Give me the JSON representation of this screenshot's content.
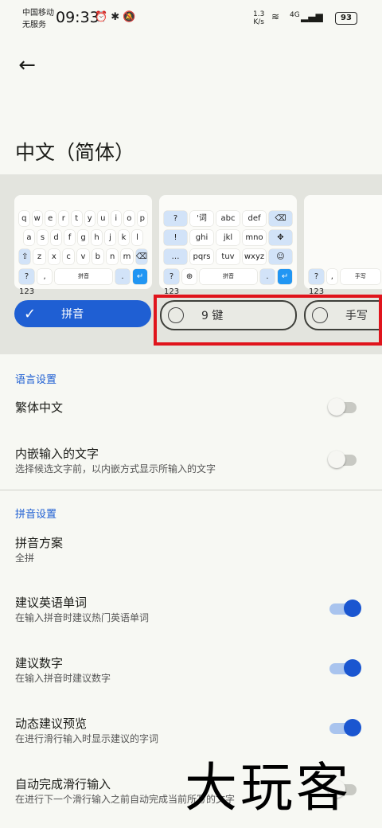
{
  "status": {
    "carrier_line1": "中国移动",
    "carrier_line2": "无服务",
    "time": "09:33",
    "net_speed": "1.3",
    "net_unit": "K/s",
    "signal": "4G",
    "battery": "93"
  },
  "header": {
    "title": "中文（简体）"
  },
  "keyboards": {
    "qwerty_rows": [
      [
        "q",
        "w",
        "e",
        "r",
        "t",
        "y",
        "u",
        "i",
        "o",
        "p"
      ],
      [
        "a",
        "s",
        "d",
        "f",
        "g",
        "h",
        "j",
        "k",
        "l"
      ],
      [
        "⇧",
        "z",
        "x",
        "c",
        "v",
        "b",
        "n",
        "m",
        "⌫"
      ],
      [
        "?123",
        ",",
        "拼音",
        ".",
        "↵"
      ]
    ],
    "nine_rows": [
      [
        "?",
        "'词",
        "abc",
        "def",
        "⌫"
      ],
      [
        "!",
        "ghi",
        "jkl",
        "mno",
        "✥"
      ],
      [
        "…",
        "pqrs",
        "tuv",
        "wxyz",
        "☺"
      ],
      [
        "?123",
        "⊕",
        "拼音",
        ".",
        "↵"
      ]
    ],
    "handwriting_row": [
      "?123",
      ",",
      "手写"
    ]
  },
  "layouts": [
    {
      "label": "拼音",
      "selected": true
    },
    {
      "label": "9 键",
      "selected": false
    },
    {
      "label": "手写",
      "selected": false
    }
  ],
  "sections": {
    "lang": {
      "header": "语言设置",
      "items": [
        {
          "title": "繁体中文",
          "on": false
        },
        {
          "title": "内嵌输入的文字",
          "sub": "选择候选文字前，以内嵌方式显示所输入的文字",
          "on": false
        }
      ]
    },
    "pinyin": {
      "header": "拼音设置",
      "scheme_title": "拼音方案",
      "scheme_value": "全拼",
      "items": [
        {
          "title": "建议英语单词",
          "sub": "在输入拼音时建议热门英语单词",
          "on": true
        },
        {
          "title": "建议数字",
          "sub": "在输入拼音时建议数字",
          "on": true
        },
        {
          "title": "动态建议预览",
          "sub": "在进行滑行输入时显示建议的字词",
          "on": true
        },
        {
          "title": "自动完成滑行输入",
          "sub": "在进行下一个滑行输入之前自动完成当前所写的文字",
          "on": false
        }
      ]
    }
  },
  "watermark": "大玩客"
}
